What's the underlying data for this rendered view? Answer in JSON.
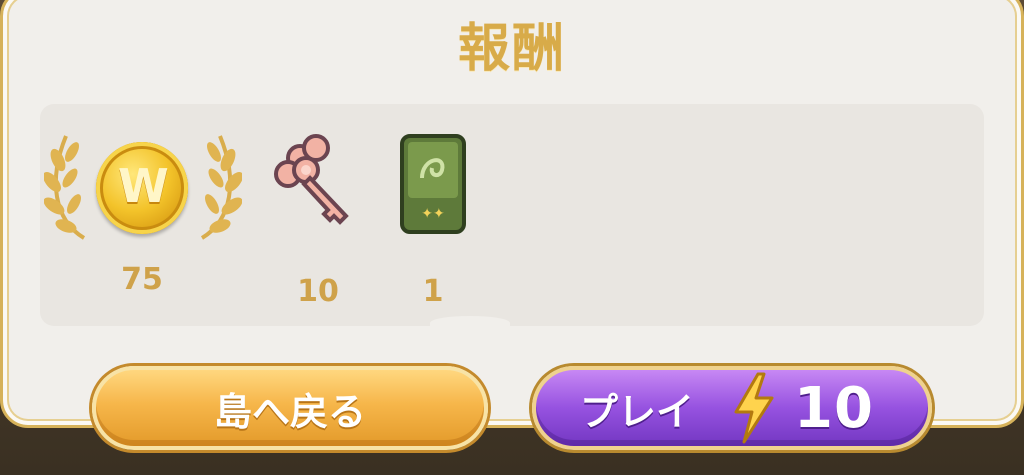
{
  "title": "報酬",
  "rewards": [
    {
      "icon": "gold-coin-icon",
      "amount": "75"
    },
    {
      "icon": "key-icon",
      "amount": "10"
    },
    {
      "icon": "card-pack-icon",
      "amount": "1"
    }
  ],
  "coin_face_glyph": "W",
  "buttons": {
    "back_label": "島へ戻る",
    "play_label": "プレイ",
    "play_cost": "10"
  },
  "colors": {
    "gold_text": "#d8ab49",
    "back_button": "#f6b64a",
    "play_button": "#9652e0"
  }
}
